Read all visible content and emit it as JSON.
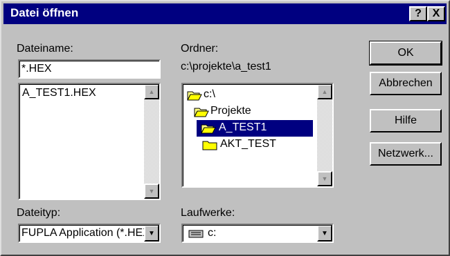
{
  "title": "Datei öffnen",
  "title_buttons": {
    "help": "?",
    "close": "X"
  },
  "filename": {
    "label": "Dateiname:",
    "value": "*.HEX",
    "files": [
      "A_TEST1.HEX"
    ]
  },
  "folder": {
    "label": "Ordner:",
    "path": "c:\\projekte\\a_test1",
    "tree": [
      "c:\\",
      "Projekte",
      "A_TEST1",
      "AKT_TEST"
    ]
  },
  "filetype": {
    "label": "Dateityp:",
    "value": "FUPLA Application (*.HEX)"
  },
  "drives": {
    "label": "Laufwerke:",
    "value": "c:"
  },
  "buttons": {
    "ok": "OK",
    "cancel": "Abbrechen",
    "help": "Hilfe",
    "network": "Netzwerk..."
  }
}
